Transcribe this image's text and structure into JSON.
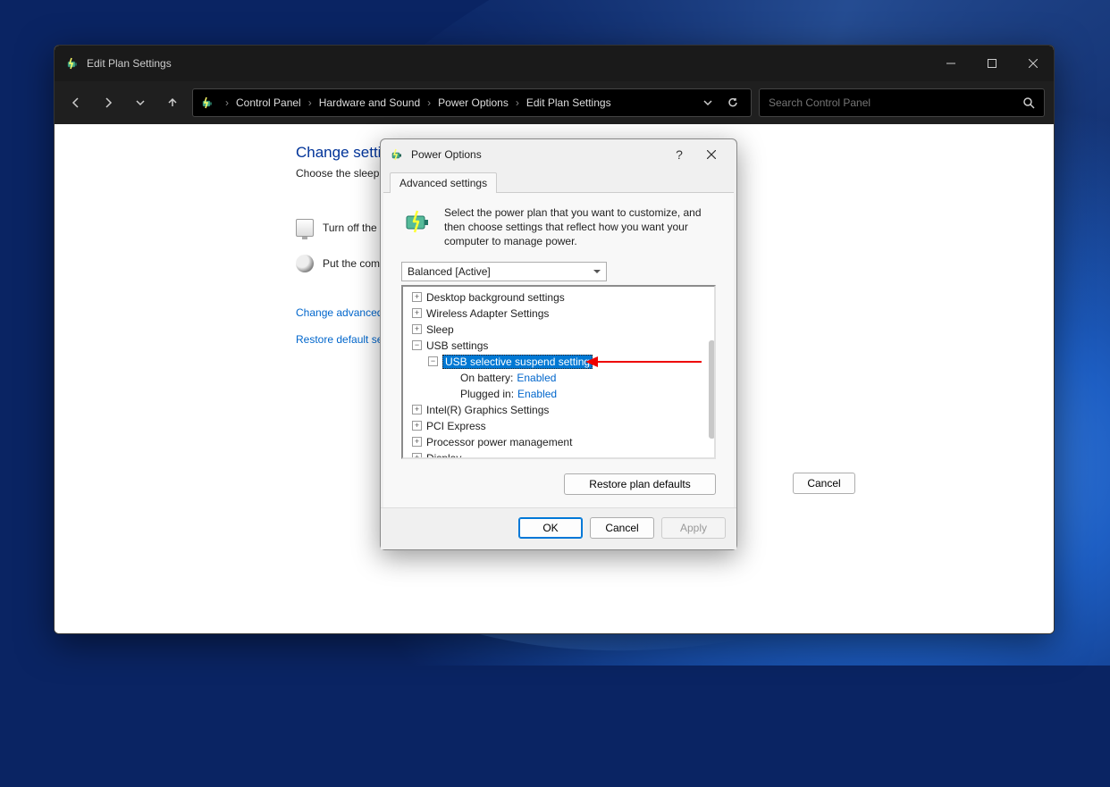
{
  "main_window": {
    "title": "Edit Plan Settings",
    "breadcrumbs": [
      "Control Panel",
      "Hardware and Sound",
      "Power Options",
      "Edit Plan Settings"
    ],
    "search_placeholder": "Search Control Panel",
    "heading": "Change settings for the plan:",
    "description": "Choose the sleep and display settings that you want your computer to use.",
    "row_display": "Turn off the display:",
    "row_sleep": "Put the computer to sleep:",
    "link_advanced": "Change advanced power settings",
    "link_restore": "Restore default settings for this plan",
    "cancel": "Cancel"
  },
  "dialog": {
    "title": "Power Options",
    "tab": "Advanced settings",
    "intro": "Select the power plan that you want to customize, and then choose settings that reflect how you want your computer to manage power.",
    "plan_selected": "Balanced [Active]",
    "tree": {
      "desktop_bg": "Desktop background settings",
      "wireless": "Wireless Adapter Settings",
      "sleep": "Sleep",
      "usb": "USB settings",
      "usb_suspend": "USB selective suspend setting",
      "on_battery_label": "On battery:",
      "on_battery_value": "Enabled",
      "plugged_in_label": "Plugged in:",
      "plugged_in_value": "Enabled",
      "intel_gfx": "Intel(R) Graphics Settings",
      "pci": "PCI Express",
      "processor": "Processor power management",
      "display": "Display"
    },
    "restore_defaults": "Restore plan defaults",
    "ok": "OK",
    "cancel": "Cancel",
    "apply": "Apply"
  }
}
